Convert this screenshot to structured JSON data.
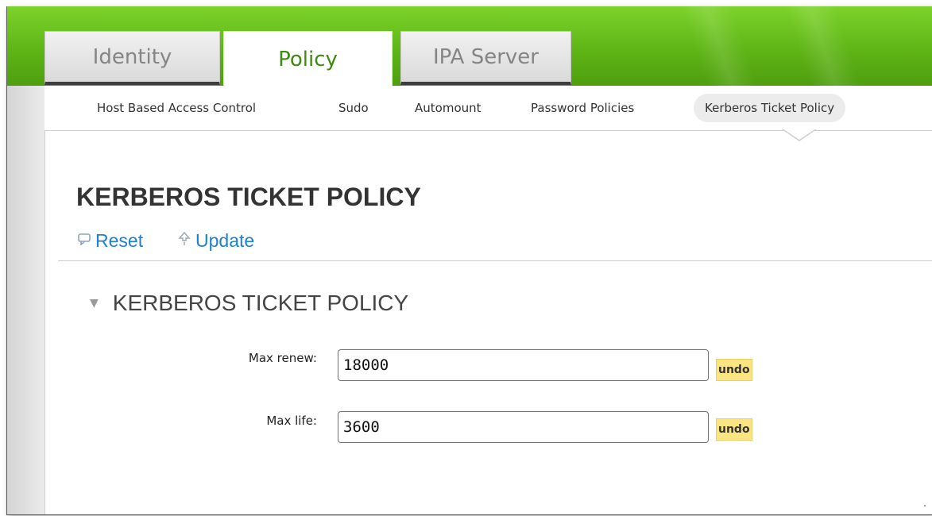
{
  "tabs": [
    {
      "label": "Identity",
      "active": false
    },
    {
      "label": "Policy",
      "active": true
    },
    {
      "label": "IPA Server",
      "active": false
    }
  ],
  "subnav": [
    {
      "label": "Host Based Access Control",
      "active": false
    },
    {
      "label": "Sudo",
      "active": false
    },
    {
      "label": "Automount",
      "active": false
    },
    {
      "label": "Password Policies",
      "active": false
    },
    {
      "label": "Kerberos Ticket Policy",
      "active": true
    }
  ],
  "page": {
    "title": "KERBEROS TICKET POLICY",
    "actions": {
      "reset_label": "Reset",
      "reset_icon": "reset-icon",
      "update_label": "Update",
      "update_icon": "update-icon"
    }
  },
  "section": {
    "title": "KERBEROS TICKET POLICY",
    "expanded": true,
    "fields": [
      {
        "label": "Max renew:",
        "value": "18000",
        "undo_label": "undo"
      },
      {
        "label": "Max life:",
        "value": "3600",
        "undo_label": "undo"
      }
    ]
  },
  "colors": {
    "header_green": "#5fb516",
    "active_tab_text": "#3f8a0f",
    "link_blue": "#1f7fd1",
    "undo_yellow": "#fbe580"
  }
}
